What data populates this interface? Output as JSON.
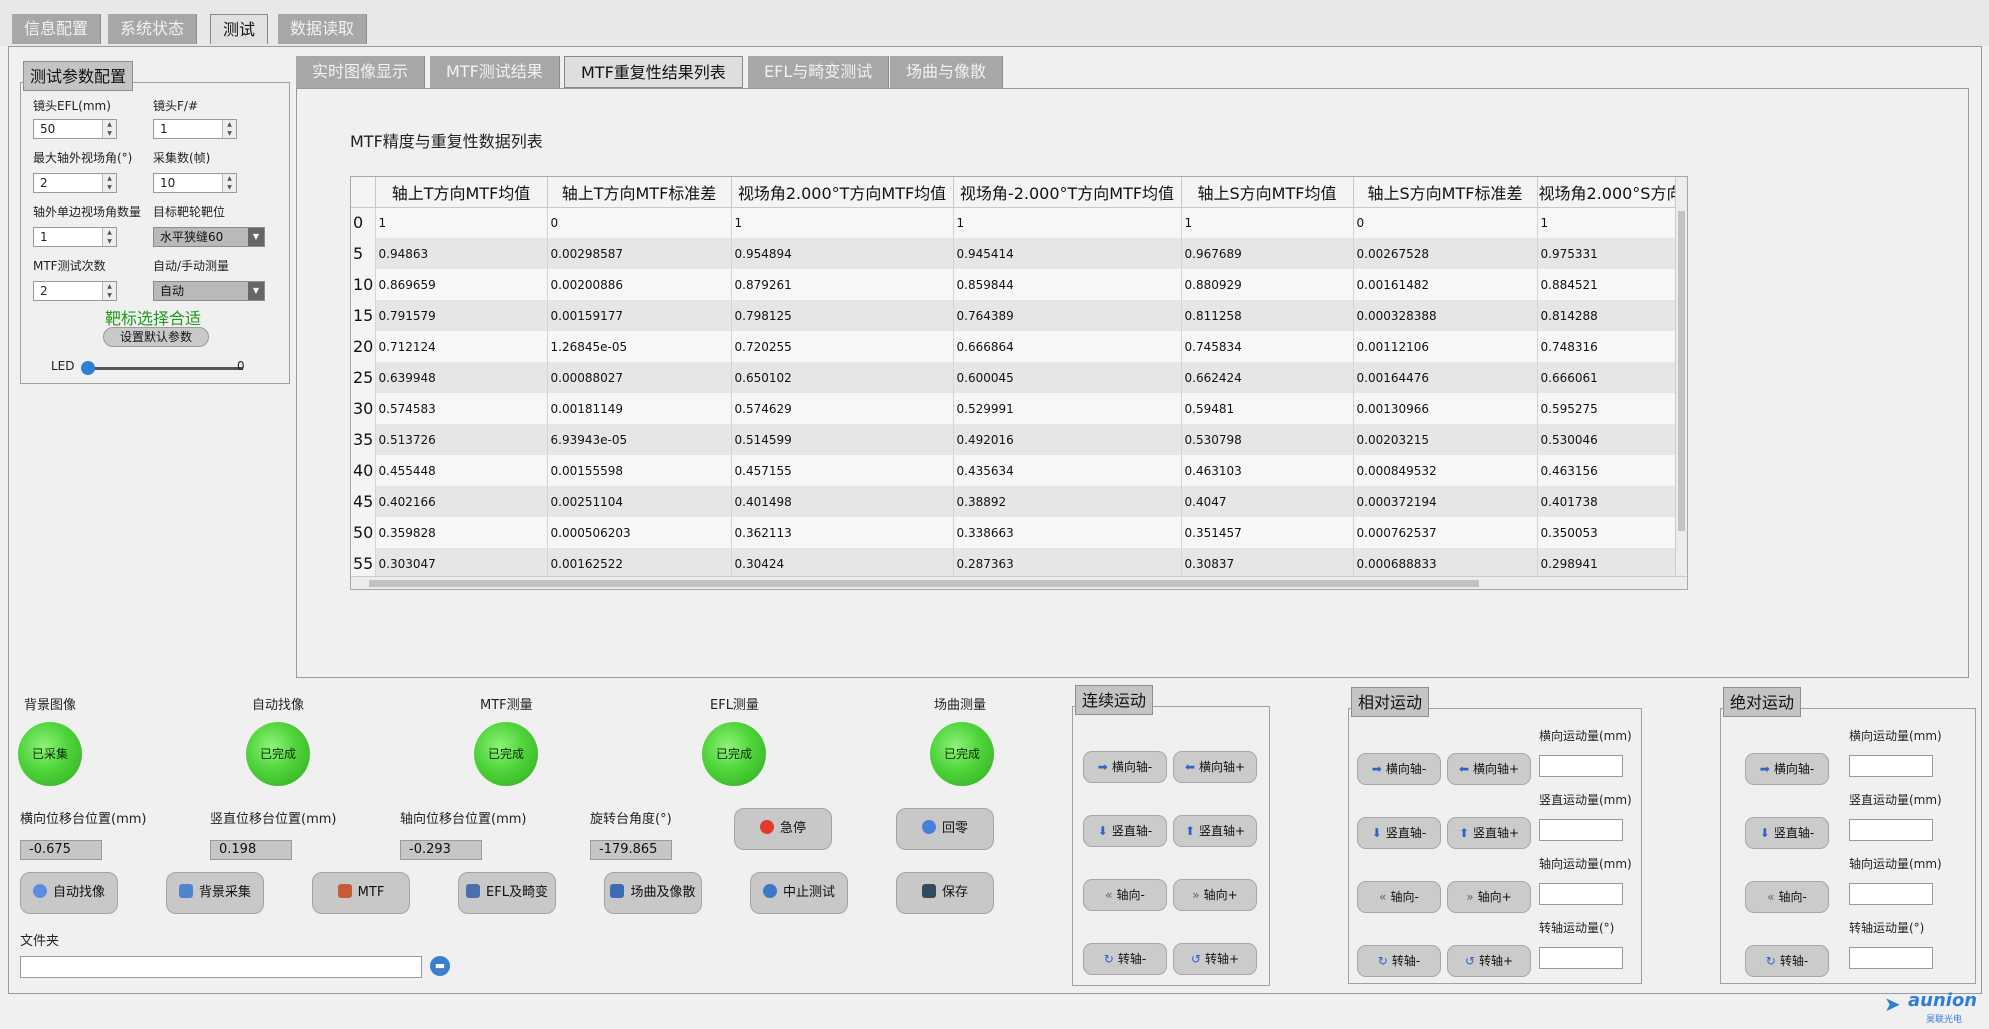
{
  "top_tabs": [
    "信息配置",
    "系统状态",
    "测试",
    "数据读取"
  ],
  "param_panel": {
    "title": "测试参数配置",
    "fields": {
      "efl_label": "镜头EFL(mm)",
      "efl_value": "50",
      "fnum_label": "镜头F/#",
      "fnum_value": "1",
      "max_angle_label": "最大轴外视场角(°)",
      "max_angle_value": "2",
      "frames_label": "采集数(帧)",
      "frames_value": "10",
      "off_axis_count_label": "轴外单边视场角数量",
      "off_axis_count_value": "1",
      "target_label": "目标靶轮靶位",
      "target_value": "水平狭缝60",
      "mtf_times_label": "MTF测试次数",
      "mtf_times_value": "2",
      "mode_label": "自动/手动测量",
      "mode_value": "自动"
    },
    "status_text": "靶标选择合适",
    "default_button": "设置默认参数",
    "led_label": "LED",
    "led_value": "0"
  },
  "sub_tabs": [
    "实时图像显示",
    "MTF测试结果",
    "MTF重复性结果列表",
    "EFL与畸变测试",
    "场曲与像散"
  ],
  "table_title": "MTF精度与重复性数据列表",
  "table": {
    "columns": [
      "轴上T方向MTF均值",
      "轴上T方向MTF标准差",
      "视场角2.000°T方向MTF均值",
      "视场角-2.000°T方向MTF均值",
      "轴上S方向MTF均值",
      "轴上S方向MTF标准差",
      "视场角2.000°S方向"
    ],
    "rows": [
      {
        "h": "0",
        "c": [
          "1",
          "0",
          "1",
          "1",
          "1",
          "0",
          "1"
        ]
      },
      {
        "h": "5",
        "c": [
          "0.94863",
          "0.00298587",
          "0.954894",
          "0.945414",
          "0.967689",
          "0.00267528",
          "0.975331"
        ]
      },
      {
        "h": "10",
        "c": [
          "0.869659",
          "0.00200886",
          "0.879261",
          "0.859844",
          "0.880929",
          "0.00161482",
          "0.884521"
        ]
      },
      {
        "h": "15",
        "c": [
          "0.791579",
          "0.00159177",
          "0.798125",
          "0.764389",
          "0.811258",
          "0.000328388",
          "0.814288"
        ]
      },
      {
        "h": "20",
        "c": [
          "0.712124",
          "1.26845e-05",
          "0.720255",
          "0.666864",
          "0.745834",
          "0.00112106",
          "0.748316"
        ]
      },
      {
        "h": "25",
        "c": [
          "0.639948",
          "0.00088027",
          "0.650102",
          "0.600045",
          "0.662424",
          "0.00164476",
          "0.666061"
        ]
      },
      {
        "h": "30",
        "c": [
          "0.574583",
          "0.00181149",
          "0.574629",
          "0.529991",
          "0.59481",
          "0.00130966",
          "0.595275"
        ]
      },
      {
        "h": "35",
        "c": [
          "0.513726",
          "6.93943e-05",
          "0.514599",
          "0.492016",
          "0.530798",
          "0.00203215",
          "0.530046"
        ]
      },
      {
        "h": "40",
        "c": [
          "0.455448",
          "0.00155598",
          "0.457155",
          "0.435634",
          "0.463103",
          "0.000849532",
          "0.463156"
        ]
      },
      {
        "h": "45",
        "c": [
          "0.402166",
          "0.00251104",
          "0.401498",
          "0.38892",
          "0.4047",
          "0.000372194",
          "0.401738"
        ]
      },
      {
        "h": "50",
        "c": [
          "0.359828",
          "0.000506203",
          "0.362113",
          "0.338663",
          "0.351457",
          "0.000762537",
          "0.350053"
        ]
      },
      {
        "h": "55",
        "c": [
          "0.303047",
          "0.00162522",
          "0.30424",
          "0.287363",
          "0.30837",
          "0.000688833",
          "0.298941"
        ]
      }
    ]
  },
  "indicators": [
    {
      "label": "背景图像",
      "state": "已采集"
    },
    {
      "label": "自动找像",
      "state": "已完成"
    },
    {
      "label": "MTF测量",
      "state": "已完成"
    },
    {
      "label": "EFL测量",
      "state": "已完成"
    },
    {
      "label": "场曲测量",
      "state": "已完成"
    }
  ],
  "positions": [
    {
      "label": "横向位移台位置(mm)",
      "value": "-0.675"
    },
    {
      "label": "竖直位移台位置(mm)",
      "value": "0.198"
    },
    {
      "label": "轴向位移台位置(mm)",
      "value": "-0.293"
    },
    {
      "label": "旋转台角度(°)",
      "value": "-179.865"
    }
  ],
  "buttons": {
    "estop": "急停",
    "home": "回零",
    "auto_focus": "自动找像",
    "bg_capture": "背景采集",
    "mtf": "MTF",
    "efl": "EFL及畸变",
    "field_curve": "场曲及像散",
    "stop_test": "中止测试",
    "save": "保存"
  },
  "folder_label": "文件夹",
  "motion": {
    "continuous": {
      "title": "连续运动",
      "buttons": [
        "横向轴-",
        "横向轴+",
        "竖直轴-",
        "竖直轴+",
        "轴向-",
        "轴向+",
        "转轴-",
        "转轴+"
      ]
    },
    "relative": {
      "title": "相对运动",
      "buttons": [
        "横向轴-",
        "横向轴+",
        "竖直轴-",
        "竖直轴+",
        "轴向-",
        "轴向+",
        "转轴-",
        "转轴+"
      ],
      "input_labels": [
        "横向运动量(mm)",
        "竖直运动量(mm)",
        "轴向运动量(mm)",
        "转轴运动量(°)"
      ]
    },
    "absolute": {
      "title": "绝对运动",
      "buttons": [
        "横向轴-",
        "竖直轴-",
        "轴向-",
        "转轴-"
      ],
      "input_labels": [
        "横向运动量(mm)",
        "竖直运动量(mm)",
        "轴向运动量(mm)",
        "转轴运动量(°)"
      ]
    }
  },
  "logo": {
    "text": "aunion",
    "sub": "昊联光电"
  }
}
